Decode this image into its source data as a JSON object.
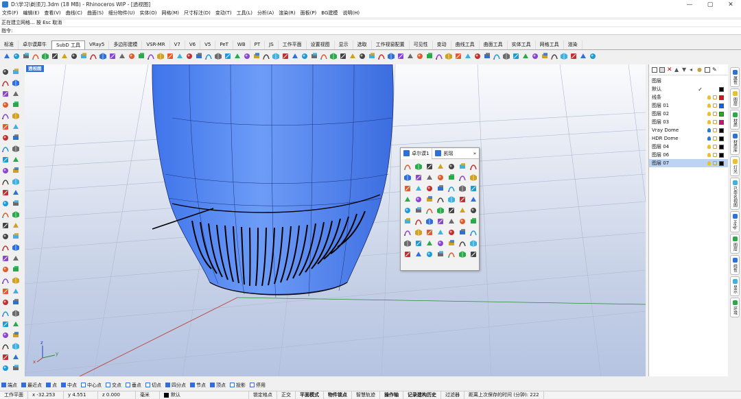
{
  "window": {
    "title": "D:\\学习\\剃须刀.3dm (18 MB) - Rhinoceros WIP - [透视图]"
  },
  "menu": [
    "文件(F)",
    "编辑(E)",
    "查看(V)",
    "曲线(C)",
    "曲面(S)",
    "细分物件(U)",
    "实体(O)",
    "网格(M)",
    "尺寸标注(D)",
    "变动(T)",
    "工具(L)",
    "分析(A)",
    "渲染(R)",
    "面板(P)",
    "BG建模",
    "说明(H)"
  ],
  "command": {
    "history": "正在建立网格... 按 Esc 取消",
    "prompt": "指令:"
  },
  "tabs": [
    "标准",
    "卓尔谟犀牛",
    "SubD 工具",
    "VRay5",
    "多边形建模",
    "VSR-MR",
    "V7",
    "V6",
    "V5",
    "PeT",
    "WB",
    "PT",
    "JS",
    "工作平面",
    "设置视图",
    "显示",
    "选取",
    "工作视窗配置",
    "可见性",
    "变动",
    "曲线工具",
    "曲面工具",
    "实体工具",
    "网格工具",
    "渲染"
  ],
  "active_tab": "SubD 工具",
  "viewport": {
    "label": "透视图"
  },
  "floating_panel": {
    "tabs": [
      "卓尔谟1",
      "凯瑶"
    ],
    "more": "»"
  },
  "layers": {
    "header": "图层",
    "rows": [
      {
        "name": "默认",
        "color": "#000000",
        "current": true,
        "bulb": "#000000"
      },
      {
        "name": "线条",
        "color": "#e01010",
        "bulb": "#e8c030"
      },
      {
        "name": "图层 01",
        "color": "#1560e0",
        "bulb": "#e8c030"
      },
      {
        "name": "图层 02",
        "color": "#20b020",
        "bulb": "#e8c030"
      },
      {
        "name": "图层 03",
        "color": "#d01070",
        "bulb": "#e8c030"
      },
      {
        "name": "Vray Dome",
        "color": "#000000",
        "bulb": "#2a78d8"
      },
      {
        "name": "HDR Dome",
        "color": "#000000",
        "bulb": "#2a78d8"
      },
      {
        "name": "图层 04",
        "color": "#000000",
        "bulb": "#e8c030"
      },
      {
        "name": "图层 06",
        "color": "#000000",
        "bulb": "#e8c030"
      },
      {
        "name": "图层 07",
        "color": "#000000",
        "bulb": "#e8c030",
        "selected": true
      }
    ]
  },
  "side_tabs": [
    "属性",
    "图层",
    "材质",
    "材质库",
    "灯光",
    "已命名视图",
    "Help",
    "图层",
    "线性",
    "显示",
    "环境"
  ],
  "osnap": [
    {
      "label": "端点",
      "on": true
    },
    {
      "label": "最近点",
      "on": true
    },
    {
      "label": "点",
      "on": true
    },
    {
      "label": "中点",
      "on": true
    },
    {
      "label": "中心点",
      "on": false
    },
    {
      "label": "交点",
      "on": false
    },
    {
      "label": "垂点",
      "on": false
    },
    {
      "label": "切点",
      "on": false
    },
    {
      "label": "四分点",
      "on": true
    },
    {
      "label": "节点",
      "on": true
    },
    {
      "label": "顶点",
      "on": true
    },
    {
      "label": "投影",
      "on": false
    },
    {
      "label": "停用",
      "on": false
    }
  ],
  "status": {
    "cplane": "工作平面",
    "x": "x -32.253",
    "y": "y 4.551",
    "z": "z 0.000",
    "unit": "毫米",
    "layer": "默认",
    "toggles": [
      "锁定格点",
      "正交",
      "平面模式",
      "物件锁点",
      "智慧轨迹",
      "操作轴",
      "记录建构历史",
      "过滤器"
    ],
    "autosave": "距离上次保存的时间 (分钟): 222"
  },
  "colors": {
    "accent": "#2f6fd6",
    "model_blue": "#5b8ff5"
  }
}
